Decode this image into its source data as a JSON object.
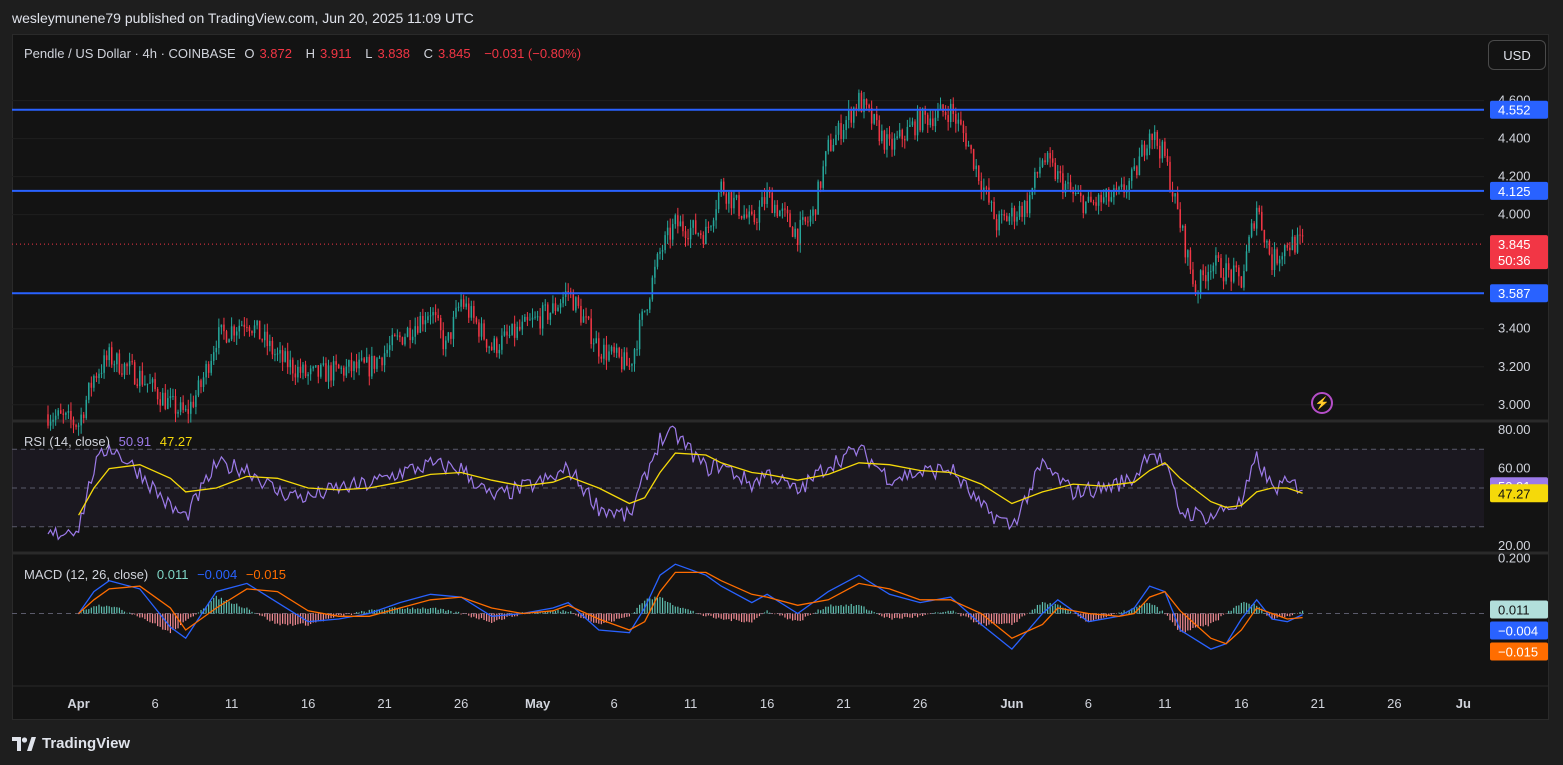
{
  "header": {
    "published": "wesleymunene79 published on TradingView.com, Jun 20, 2025 11:09 UTC"
  },
  "symbol_legend": {
    "title": "Pendle / US Dollar · 4h · COINBASE",
    "open_label": "O",
    "open": "3.872",
    "high_label": "H",
    "high": "3.911",
    "low_label": "L",
    "low": "3.838",
    "close_label": "C",
    "close": "3.845",
    "change": "−0.031 (−0.80%)"
  },
  "currency_button": "USD",
  "rsi_legend": {
    "title": "RSI (14, close)",
    "rsi": "50.91",
    "ma": "47.27"
  },
  "macd_legend": {
    "title": "MACD (12, 26, close)",
    "hist": "0.011",
    "macd": "−0.004",
    "signal": "−0.015"
  },
  "footer": {
    "brand": "TradingView"
  },
  "colors": {
    "up": "#26a69a",
    "down": "#f23645",
    "level_line": "#2962ff",
    "rsi": "#9c7ae8",
    "rsi_ma": "#f5d90a",
    "macd": "#2962ff",
    "signal": "#ff6d00",
    "last_price_label": "#f23645"
  },
  "chart_data": [
    {
      "type": "candlestick",
      "pane": "price",
      "y_ticks": [
        "4.600",
        "4.400",
        "4.200",
        "4.000",
        "3.400",
        "3.200",
        "3.000"
      ],
      "ylim": [
        2.92,
        4.74
      ],
      "x_ticks": [
        "Apr",
        "6",
        "11",
        "16",
        "21",
        "26",
        "May",
        "6",
        "11",
        "16",
        "21",
        "26",
        "Jun",
        "6",
        "11",
        "16",
        "21",
        "26",
        "Ju"
      ],
      "horizontal_levels": [
        {
          "value": 4.552,
          "label": "4.552"
        },
        {
          "value": 4.125,
          "label": "4.125"
        },
        {
          "value": 3.587,
          "label": "3.587"
        }
      ],
      "last_price": {
        "value": 3.845,
        "label": "3.845",
        "countdown": "50:36"
      },
      "close_path": [
        [
          "Mar 30",
          2.95
        ],
        [
          "Apr 1",
          2.9
        ],
        [
          "Apr 2",
          3.15
        ],
        [
          "Apr 3",
          3.25
        ],
        [
          "Apr 5",
          3.15
        ],
        [
          "Apr 7",
          3.0
        ],
        [
          "Apr 8",
          2.95
        ],
        [
          "Apr 9",
          3.1
        ],
        [
          "Apr 10",
          3.35
        ],
        [
          "Apr 12",
          3.45
        ],
        [
          "Apr 14",
          3.25
        ],
        [
          "Apr 16",
          3.15
        ],
        [
          "Apr 18",
          3.18
        ],
        [
          "Apr 20",
          3.2
        ],
        [
          "Apr 22",
          3.35
        ],
        [
          "Apr 24",
          3.5
        ],
        [
          "Apr 25",
          3.3
        ],
        [
          "Apr 26",
          3.55
        ],
        [
          "Apr 28",
          3.3
        ],
        [
          "Apr 30",
          3.4
        ],
        [
          "May 2",
          3.5
        ],
        [
          "May 3",
          3.6
        ],
        [
          "May 5",
          3.3
        ],
        [
          "May 7",
          3.2
        ],
        [
          "May 8",
          3.5
        ],
        [
          "May 9",
          3.8
        ],
        [
          "May 10",
          3.95
        ],
        [
          "May 12",
          3.9
        ],
        [
          "May 13",
          4.15
        ],
        [
          "May 15",
          3.95
        ],
        [
          "May 16",
          4.1
        ],
        [
          "May 18",
          3.9
        ],
        [
          "May 19",
          4.0
        ],
        [
          "May 20",
          4.35
        ],
        [
          "May 22",
          4.6
        ],
        [
          "May 24",
          4.35
        ],
        [
          "May 26",
          4.5
        ],
        [
          "May 28",
          4.55
        ],
        [
          "May 29",
          4.4
        ],
        [
          "May 31",
          3.95
        ],
        [
          "Jun 2",
          4.05
        ],
        [
          "Jun 3",
          4.3
        ],
        [
          "Jun 5",
          4.1
        ],
        [
          "Jun 6",
          4.05
        ],
        [
          "Jun 8",
          4.1
        ],
        [
          "Jun 9",
          4.2
        ],
        [
          "Jun 10",
          4.45
        ],
        [
          "Jun 11",
          4.3
        ],
        [
          "Jun 12",
          3.95
        ],
        [
          "Jun 13",
          3.6
        ],
        [
          "Jun 14",
          3.75
        ],
        [
          "Jun 16",
          3.65
        ],
        [
          "Jun 17",
          4.05
        ],
        [
          "Jun 18",
          3.75
        ],
        [
          "Jun 19",
          3.85
        ],
        [
          "Jun 20",
          3.845
        ]
      ]
    },
    {
      "type": "line",
      "pane": "rsi",
      "y_ticks": [
        "80.00",
        "60.00",
        "20.00"
      ],
      "ylim": [
        17,
        83
      ],
      "bands": [
        30,
        50,
        70
      ],
      "series": [
        {
          "name": "RSI",
          "last": 50.91,
          "label": "50.91"
        },
        {
          "name": "MA",
          "last": 47.27,
          "label": "47.27"
        }
      ],
      "rsi_path": [
        [
          "Mar 30",
          25
        ],
        [
          "Apr 1",
          30
        ],
        [
          "Apr 2",
          60
        ],
        [
          "Apr 3",
          72
        ],
        [
          "Apr 5",
          58
        ],
        [
          "Apr 7",
          40
        ],
        [
          "Apr 8",
          35
        ],
        [
          "Apr 10",
          62
        ],
        [
          "Apr 12",
          60
        ],
        [
          "Apr 14",
          48
        ],
        [
          "Apr 16",
          45
        ],
        [
          "Apr 18",
          50
        ],
        [
          "Apr 20",
          52
        ],
        [
          "Apr 22",
          58
        ],
        [
          "Apr 24",
          62
        ],
        [
          "Apr 26",
          60
        ],
        [
          "Apr 28",
          45
        ],
        [
          "Apr 30",
          50
        ],
        [
          "May 2",
          55
        ],
        [
          "May 3",
          60
        ],
        [
          "May 5",
          40
        ],
        [
          "May 7",
          35
        ],
        [
          "May 8",
          55
        ],
        [
          "May 9",
          75
        ],
        [
          "May 10",
          78
        ],
        [
          "May 12",
          60
        ],
        [
          "May 13",
          62
        ],
        [
          "May 15",
          52
        ],
        [
          "May 16",
          58
        ],
        [
          "May 18",
          48
        ],
        [
          "May 20",
          62
        ],
        [
          "May 22",
          70
        ],
        [
          "May 24",
          55
        ],
        [
          "May 26",
          58
        ],
        [
          "May 28",
          60
        ],
        [
          "May 30",
          40
        ],
        [
          "Jun 1",
          30
        ],
        [
          "Jun 3",
          62
        ],
        [
          "Jun 5",
          48
        ],
        [
          "Jun 7",
          50
        ],
        [
          "Jun 9",
          55
        ],
        [
          "Jun 10",
          70
        ],
        [
          "Jun 11",
          62
        ],
        [
          "Jun 12",
          38
        ],
        [
          "Jun 14",
          35
        ],
        [
          "Jun 15",
          40
        ],
        [
          "Jun 16",
          42
        ],
        [
          "Jun 17",
          65
        ],
        [
          "Jun 18",
          50
        ],
        [
          "Jun 19",
          52
        ],
        [
          "Jun 20",
          50.91
        ]
      ],
      "ma_path": [
        [
          "Apr 1",
          36
        ],
        [
          "Apr 2",
          50
        ],
        [
          "Apr 3",
          60
        ],
        [
          "Apr 5",
          62
        ],
        [
          "Apr 7",
          55
        ],
        [
          "Apr 8",
          48
        ],
        [
          "Apr 10",
          50
        ],
        [
          "Apr 12",
          56
        ],
        [
          "Apr 14",
          55
        ],
        [
          "Apr 16",
          50
        ],
        [
          "Apr 18",
          49
        ],
        [
          "Apr 20",
          50
        ],
        [
          "Apr 22",
          53
        ],
        [
          "Apr 24",
          57
        ],
        [
          "Apr 26",
          58
        ],
        [
          "Apr 28",
          54
        ],
        [
          "Apr 30",
          51
        ],
        [
          "May 2",
          53
        ],
        [
          "May 3",
          56
        ],
        [
          "May 5",
          50
        ],
        [
          "May 7",
          42
        ],
        [
          "May 8",
          45
        ],
        [
          "May 9",
          58
        ],
        [
          "May 10",
          68
        ],
        [
          "May 12",
          67
        ],
        [
          "May 13",
          63
        ],
        [
          "May 15",
          58
        ],
        [
          "May 16",
          57
        ],
        [
          "May 18",
          54
        ],
        [
          "May 20",
          57
        ],
        [
          "May 22",
          63
        ],
        [
          "May 24",
          62
        ],
        [
          "May 26",
          59
        ],
        [
          "May 28",
          58
        ],
        [
          "May 30",
          52
        ],
        [
          "Jun 1",
          42
        ],
        [
          "Jun 3",
          48
        ],
        [
          "Jun 5",
          52
        ],
        [
          "Jun 7",
          51
        ],
        [
          "Jun 9",
          53
        ],
        [
          "Jun 10",
          59
        ],
        [
          "Jun 11",
          63
        ],
        [
          "Jun 12",
          55
        ],
        [
          "Jun 14",
          43
        ],
        [
          "Jun 15",
          40
        ],
        [
          "Jun 16",
          41
        ],
        [
          "Jun 17",
          48
        ],
        [
          "Jun 18",
          50
        ],
        [
          "Jun 19",
          50
        ],
        [
          "Jun 20",
          47.27
        ]
      ]
    },
    {
      "type": "line",
      "pane": "macd",
      "y_ticks": [
        "0.200"
      ],
      "ylim": [
        -0.25,
        0.21
      ],
      "series": [
        {
          "name": "Histogram",
          "last": 0.011,
          "label": "0.011"
        },
        {
          "name": "MACD",
          "last": -0.004,
          "label": "−0.004"
        },
        {
          "name": "Signal",
          "last": -0.015,
          "label": "−0.015"
        }
      ],
      "macd_path": [
        [
          "Apr 1",
          0.0
        ],
        [
          "Apr 2",
          0.08
        ],
        [
          "Apr 3",
          0.12
        ],
        [
          "Apr 5",
          0.09
        ],
        [
          "Apr 7",
          -0.05
        ],
        [
          "Apr 8",
          -0.09
        ],
        [
          "Apr 10",
          0.08
        ],
        [
          "Apr 12",
          0.11
        ],
        [
          "Apr 14",
          0.04
        ],
        [
          "Apr 16",
          -0.03
        ],
        [
          "Apr 18",
          -0.02
        ],
        [
          "Apr 20",
          0.0
        ],
        [
          "Apr 22",
          0.04
        ],
        [
          "Apr 24",
          0.07
        ],
        [
          "Apr 26",
          0.06
        ],
        [
          "Apr 28",
          -0.01
        ],
        [
          "Apr 30",
          0.0
        ],
        [
          "May 2",
          0.02
        ],
        [
          "May 3",
          0.04
        ],
        [
          "May 5",
          -0.06
        ],
        [
          "May 7",
          -0.07
        ],
        [
          "May 8",
          0.02
        ],
        [
          "May 9",
          0.14
        ],
        [
          "May 10",
          0.18
        ],
        [
          "May 12",
          0.14
        ],
        [
          "May 13",
          0.1
        ],
        [
          "May 15",
          0.04
        ],
        [
          "May 16",
          0.07
        ],
        [
          "May 18",
          0.0
        ],
        [
          "May 20",
          0.08
        ],
        [
          "May 22",
          0.14
        ],
        [
          "May 24",
          0.07
        ],
        [
          "May 26",
          0.04
        ],
        [
          "May 28",
          0.06
        ],
        [
          "May 30",
          -0.04
        ],
        [
          "Jun 1",
          -0.13
        ],
        [
          "Jun 3",
          0.0
        ],
        [
          "Jun 4",
          0.05
        ],
        [
          "Jun 6",
          -0.03
        ],
        [
          "Jun 8",
          -0.01
        ],
        [
          "Jun 9",
          0.02
        ],
        [
          "Jun 10",
          0.1
        ],
        [
          "Jun 11",
          0.08
        ],
        [
          "Jun 12",
          -0.06
        ],
        [
          "Jun 14",
          -0.13
        ],
        [
          "Jun 15",
          -0.11
        ],
        [
          "Jun 16",
          -0.02
        ],
        [
          "Jun 17",
          0.05
        ],
        [
          "Jun 18",
          -0.02
        ],
        [
          "Jun 19",
          -0.03
        ],
        [
          "Jun 20",
          -0.004
        ]
      ],
      "signal_path": [
        [
          "Apr 1",
          0.0
        ],
        [
          "Apr 2",
          0.05
        ],
        [
          "Apr 3",
          0.09
        ],
        [
          "Apr 5",
          0.1
        ],
        [
          "Apr 7",
          0.02
        ],
        [
          "Apr 8",
          -0.06
        ],
        [
          "Apr 10",
          0.02
        ],
        [
          "Apr 12",
          0.09
        ],
        [
          "Apr 14",
          0.08
        ],
        [
          "Apr 16",
          0.01
        ],
        [
          "Apr 18",
          -0.01
        ],
        [
          "Apr 20",
          -0.01
        ],
        [
          "Apr 22",
          0.02
        ],
        [
          "Apr 24",
          0.05
        ],
        [
          "Apr 26",
          0.06
        ],
        [
          "Apr 28",
          0.02
        ],
        [
          "Apr 30",
          0.0
        ],
        [
          "May 2",
          0.01
        ],
        [
          "May 3",
          0.03
        ],
        [
          "May 5",
          -0.02
        ],
        [
          "May 7",
          -0.06
        ],
        [
          "May 8",
          -0.03
        ],
        [
          "May 9",
          0.08
        ],
        [
          "May 10",
          0.15
        ],
        [
          "May 12",
          0.15
        ],
        [
          "May 13",
          0.12
        ],
        [
          "May 15",
          0.07
        ],
        [
          "May 16",
          0.06
        ],
        [
          "May 18",
          0.03
        ],
        [
          "May 20",
          0.05
        ],
        [
          "May 22",
          0.11
        ],
        [
          "May 24",
          0.09
        ],
        [
          "May 26",
          0.05
        ],
        [
          "May 28",
          0.05
        ],
        [
          "May 30",
          0.0
        ],
        [
          "Jun 1",
          -0.09
        ],
        [
          "Jun 3",
          -0.04
        ],
        [
          "Jun 4",
          0.02
        ],
        [
          "Jun 6",
          0.0
        ],
        [
          "Jun 8",
          -0.01
        ],
        [
          "Jun 9",
          0.0
        ],
        [
          "Jun 10",
          0.06
        ],
        [
          "Jun 11",
          0.08
        ],
        [
          "Jun 12",
          0.01
        ],
        [
          "Jun 14",
          -0.09
        ],
        [
          "Jun 15",
          -0.11
        ],
        [
          "Jun 16",
          -0.06
        ],
        [
          "Jun 17",
          0.02
        ],
        [
          "Jun 18",
          0.0
        ],
        [
          "Jun 19",
          -0.02
        ],
        [
          "Jun 20",
          -0.015
        ]
      ]
    }
  ]
}
